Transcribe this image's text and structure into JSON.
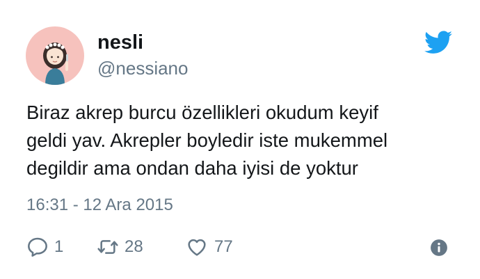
{
  "user": {
    "display_name": "nesli",
    "handle": "@nessiano",
    "avatar_icon": "avatar-illustration-icon"
  },
  "tweet": {
    "text_lines": [
      "Biraz akrep burcu özellikleri okudum keyif",
      "geldi yav. Akrepler boyledir iste mukemmel",
      "degildir ama ondan daha iyisi de yoktur"
    ],
    "timestamp": "16:31 - 12 Ara 2015"
  },
  "actions": {
    "reply_count": "1",
    "retweet_count": "28",
    "like_count": "77"
  },
  "colors": {
    "brand": "#1da1f2",
    "text": "#14171a",
    "secondary": "#657786",
    "avatar_bg": "#f6c2bd"
  }
}
